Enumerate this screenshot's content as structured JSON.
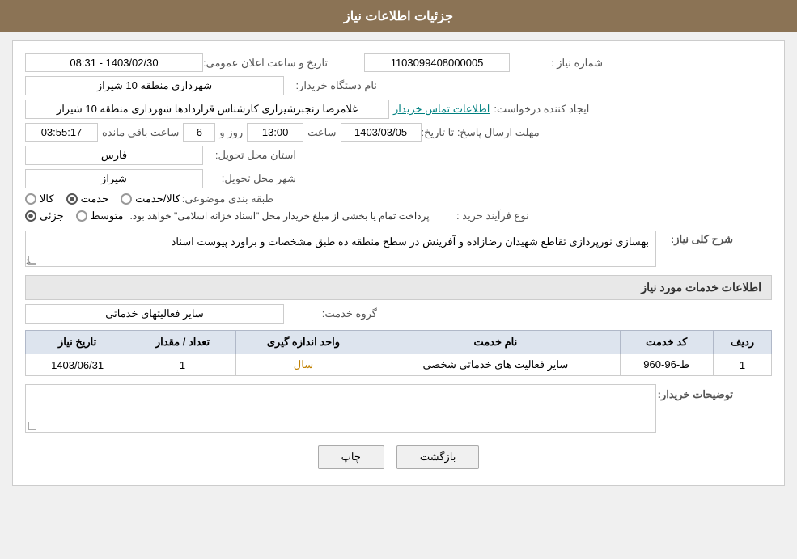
{
  "header": {
    "title": "جزئیات اطلاعات نیاز"
  },
  "fields": {
    "need_number_label": "شماره نیاز :",
    "need_number_value": "1103099408000005",
    "buyer_org_label": "نام دستگاه خریدار:",
    "buyer_org_value": "شهرداری منطقه 10 شیراز",
    "requester_label": "ایجاد کننده درخواست:",
    "requester_value": "غلامرضا رنجبرشیرازی کارشناس قراردادها شهرداری منطقه 10 شیراز",
    "contact_link": "اطلاعات تماس خریدار",
    "deadline_label": "مهلت ارسال پاسخ: تا تاریخ:",
    "deadline_date": "1403/03/05",
    "deadline_time_label": "ساعت",
    "deadline_time": "13:00",
    "deadline_days_label": "روز و",
    "deadline_days": "6",
    "deadline_remaining_label": "ساعت باقی مانده",
    "deadline_remaining": "03:55:17",
    "province_label": "استان محل تحویل:",
    "province_value": "فارس",
    "city_label": "شهر محل تحویل:",
    "city_value": "شیراز",
    "category_label": "طبقه بندی موضوعی:",
    "category_kala": "کالا",
    "category_khedmat": "خدمت",
    "category_kala_khedmat": "کالا/خدمت",
    "purchase_type_label": "نوع فرآیند خرید :",
    "purchase_jozvi": "جزئی",
    "purchase_motavaset": "متوسط",
    "purchase_note": "پرداخت تمام یا بخشی از مبلغ خریدار محل \"اسناد خزانه اسلامی\" خواهد بود.",
    "description_label": "شرح کلی نیاز:",
    "description_value": "بهسازی نورپردازی تقاطع شهیدان رضازاده و آفرینش در سطح منطقه ده طبق مشخصات و براورد پیوست اسناد",
    "services_section_title": "اطلاعات خدمات مورد نیاز",
    "service_group_label": "گروه خدمت:",
    "service_group_value": "سایر فعالیتهای خدماتی",
    "table_headers": [
      "ردیف",
      "کد خدمت",
      "نام خدمت",
      "واحد اندازه گیری",
      "تعداد / مقدار",
      "تاریخ نیاز"
    ],
    "table_rows": [
      {
        "row": "1",
        "code": "ط-96-960",
        "name": "سایر فعالیت های خدماتی شخصی",
        "unit": "سال",
        "quantity": "1",
        "date": "1403/06/31"
      }
    ],
    "buyer_comments_label": "توضیحات خریدار:",
    "btn_back": "بازگشت",
    "btn_print": "چاپ"
  },
  "announce_label": "تاریخ و ساعت اعلان عمومی:",
  "announce_value": "1403/02/30 - 08:31"
}
